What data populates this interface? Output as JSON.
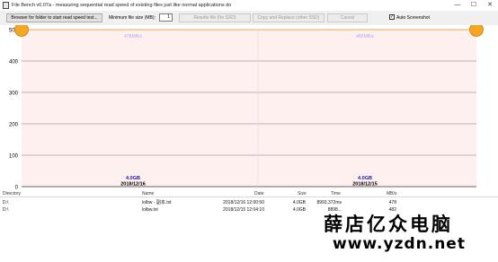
{
  "window": {
    "title": "File Bench v0.07a - measuring sequential read speed of existing files just like normal applications do",
    "minimize_glyph": "—",
    "maximize_glyph": "☐",
    "close_glyph": "✕"
  },
  "toolbar": {
    "browse_label": "Browser for folder to start read speed test...",
    "min_size_label": "Minimum file size (MB):",
    "min_size_value": "1",
    "rewrite_label": "Rewrite file (for SSD)",
    "copy_replace_label": "Copy and Replace (other SSD)",
    "cancel_label": "Cancel",
    "auto_screenshot_label": "Auto Screenshot",
    "auto_screenshot_checked": "✓"
  },
  "chart_data": {
    "type": "line",
    "ylim": [
      0,
      500
    ],
    "yticks": [
      "0",
      "100",
      "200",
      "300",
      "400",
      "500"
    ],
    "series_values": [
      500,
      500
    ],
    "bars": [
      {
        "size": "4.0GB",
        "date": "2018/12/16",
        "speed_label": "478MB/s"
      },
      {
        "size": "4.0GB",
        "date": "2018/12/15",
        "speed_label": "482MB/s"
      }
    ],
    "colors": {
      "plot_fill": "#fff0f0",
      "line": "#e8a84a",
      "marker": "#f5a623",
      "speed_text": "#b0a8e8",
      "size_text": "#1a1aa0",
      "grid": "#777777"
    }
  },
  "table": {
    "headers": {
      "directory": "Directory",
      "name": "Name",
      "date": "Date",
      "size": "Size",
      "time": "Time",
      "speed": "MB/s"
    },
    "rows": [
      {
        "directory": "D:\\",
        "name": "lolbw - 副本.txt",
        "date": "2018/12/16 12:00:50",
        "size": "4.0GB",
        "time": "8993.372ms",
        "speed": "478"
      },
      {
        "directory": "D:\\",
        "name": "lolbw.txt",
        "date": "2018/12/15 12:04:10",
        "size": "4.0GB",
        "time": "8898...",
        "speed": "482"
      }
    ]
  },
  "watermark": {
    "cn": "薛店亿众电脑",
    "url": "www.yzdn.net"
  }
}
